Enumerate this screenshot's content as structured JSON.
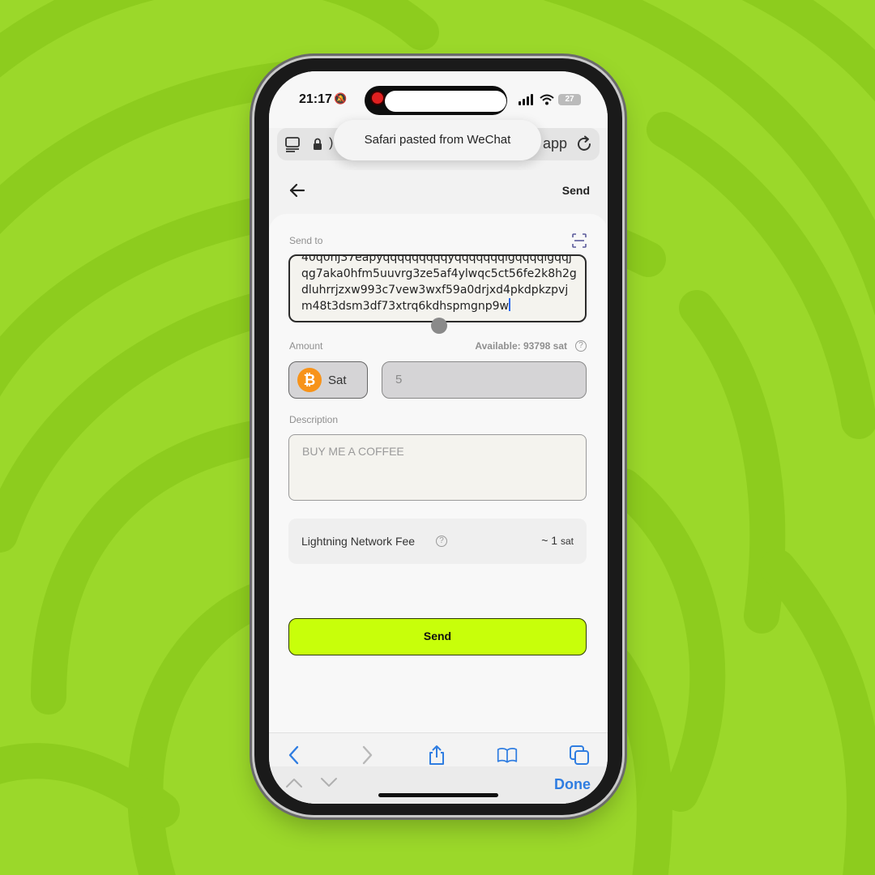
{
  "status_bar": {
    "time": "21:17",
    "battery": "27"
  },
  "browser": {
    "url_partial": ")",
    "url_end": "app",
    "toast": "Safari pasted from WeChat"
  },
  "header": {
    "title": "Send"
  },
  "send_to": {
    "label": "Send to",
    "address": "40q0nj37eapyqqqqqqqqqyqqqqqqqlgqqqqlgqqjqg7aka0hfm5uuvrg3ze5af4ylwqc5ct56fe2k8h2gdluhrrjzxw993c7vew3wxf59a0drjxd4pkdpkzpvjm48t3dsm3df73xtrq6kdhspmgnp9w"
  },
  "amount": {
    "label": "Amount",
    "available": "Available: 93798 sat",
    "currency": "Sat",
    "value": "5"
  },
  "description": {
    "label": "Description",
    "placeholder": "BUY ME A COFFEE"
  },
  "fee": {
    "label": "Lightning Network Fee",
    "value": "~ 1",
    "unit": "sat"
  },
  "send_button": "Send",
  "keyboard_bar": {
    "done": "Done"
  },
  "colors": {
    "background": "#9bd82a",
    "accent_button": "#c8ff0a",
    "bitcoin": "#f7931a",
    "ios_blue": "#2f7de1"
  }
}
